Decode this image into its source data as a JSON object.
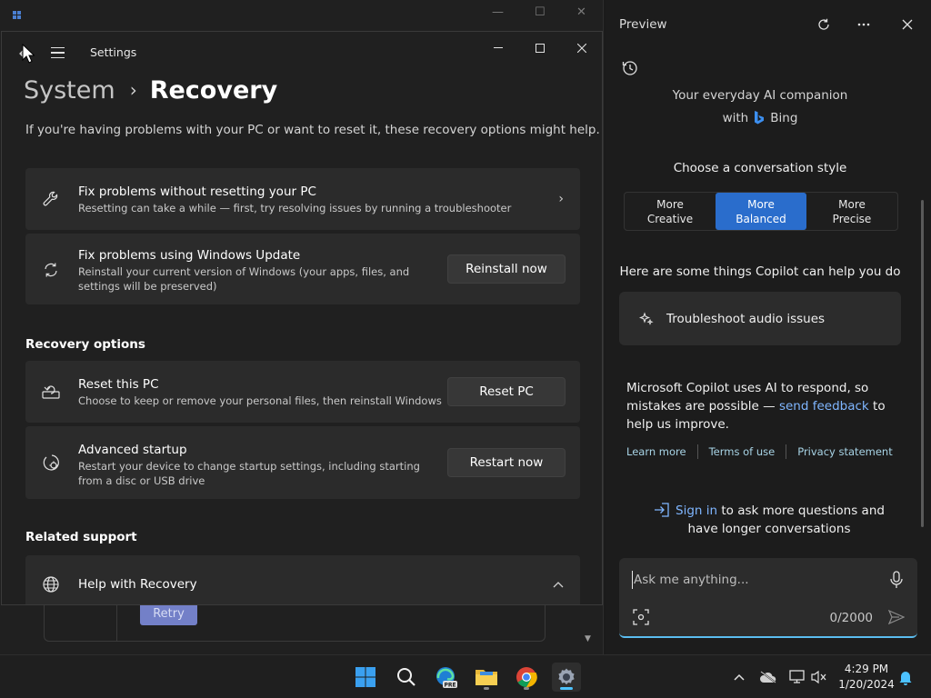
{
  "background_window": {
    "retry_label": "Retry"
  },
  "settings": {
    "app_title": "Settings",
    "breadcrumb": {
      "parent": "System",
      "separator": "›",
      "current": "Recovery"
    },
    "intro": "If you're having problems with your PC or want to reset it, these recovery options might help.",
    "fix_no_reset": {
      "title": "Fix problems without resetting your PC",
      "desc": "Resetting can take a while — first, try resolving issues by running a troubleshooter"
    },
    "fix_update": {
      "title": "Fix problems using Windows Update",
      "desc": "Reinstall your current version of Windows (your apps, files, and settings will be preserved)",
      "button": "Reinstall now"
    },
    "recovery_options_title": "Recovery options",
    "reset_pc": {
      "title": "Reset this PC",
      "desc": "Choose to keep or remove your personal files, then reinstall Windows",
      "button": "Reset PC"
    },
    "advanced_startup": {
      "title": "Advanced startup",
      "desc": "Restart your device to change startup settings, including starting from a disc or USB drive",
      "button": "Restart now"
    },
    "related_support_title": "Related support",
    "help_recovery": {
      "title": "Help with Recovery"
    }
  },
  "copilot": {
    "title": "Preview",
    "tagline_line1": "Your everyday AI companion",
    "tagline_with": "with",
    "tagline_brand": "Bing",
    "style_title": "Choose a conversation style",
    "styles": [
      {
        "line1": "More",
        "line2": "Creative",
        "active": false
      },
      {
        "line1": "More",
        "line2": "Balanced",
        "active": true
      },
      {
        "line1": "More",
        "line2": "Precise",
        "active": false
      }
    ],
    "help_title": "Here are some things Copilot can help you do",
    "suggestion": "Troubleshoot audio issues",
    "notice_before": "Microsoft Copilot uses AI to respond, so mistakes are possible — ",
    "notice_link": "send feedback",
    "notice_after": " to help us improve.",
    "links": [
      "Learn more",
      "Terms of use",
      "Privacy statement"
    ],
    "signin_link": "Sign in",
    "signin_rest": " to ask more questions and have longer conversations",
    "input_placeholder": "Ask me anything...",
    "counter": "0/2000"
  },
  "taskbar": {
    "time": "4:29 PM",
    "date": "1/20/2024",
    "edge_badge": "PRE"
  },
  "colors": {
    "accent": "#2a6dcc",
    "link": "#7fb6ff",
    "taskbar_active": "#4cc2ff"
  }
}
